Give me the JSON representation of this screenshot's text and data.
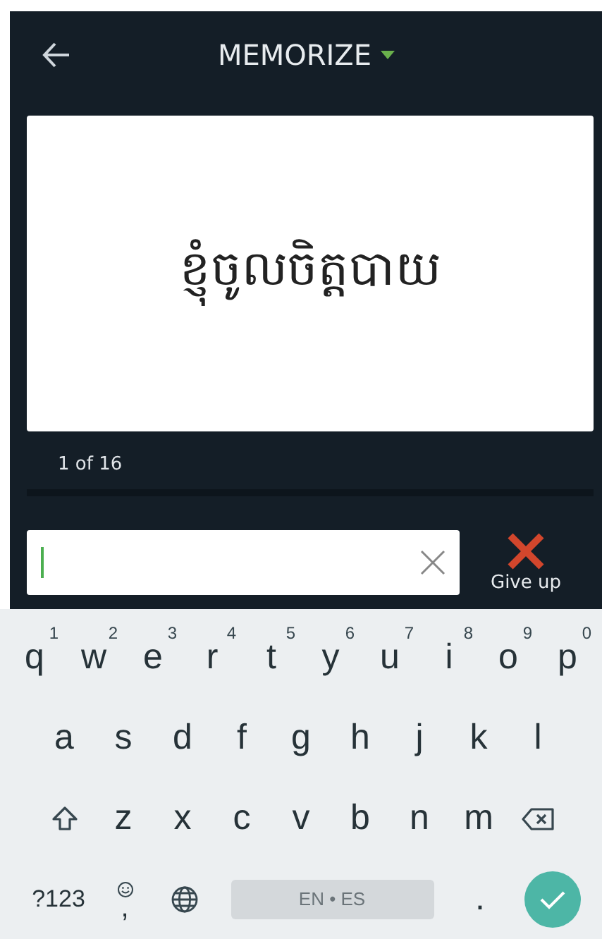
{
  "header": {
    "title": "MEMORIZE"
  },
  "card": {
    "prompt": "ខ្ញុំចូលចិត្តបាយ"
  },
  "progress": {
    "counter": "1 of 16"
  },
  "give_up": {
    "label": "Give up"
  },
  "keyboard": {
    "letter_rows": [
      [
        {
          "kind": "letter",
          "label": "q",
          "hint": "1"
        },
        {
          "kind": "letter",
          "label": "w",
          "hint": "2"
        },
        {
          "kind": "letter",
          "label": "e",
          "hint": "3"
        },
        {
          "kind": "letter",
          "label": "r",
          "hint": "4"
        },
        {
          "kind": "letter",
          "label": "t",
          "hint": "5"
        },
        {
          "kind": "letter",
          "label": "y",
          "hint": "6"
        },
        {
          "kind": "letter",
          "label": "u",
          "hint": "7"
        },
        {
          "kind": "letter",
          "label": "i",
          "hint": "8"
        },
        {
          "kind": "letter",
          "label": "o",
          "hint": "9"
        },
        {
          "kind": "letter",
          "label": "p",
          "hint": "0"
        }
      ],
      [
        {
          "kind": "letter",
          "label": "a"
        },
        {
          "kind": "letter",
          "label": "s"
        },
        {
          "kind": "letter",
          "label": "d"
        },
        {
          "kind": "letter",
          "label": "f"
        },
        {
          "kind": "letter",
          "label": "g"
        },
        {
          "kind": "letter",
          "label": "h"
        },
        {
          "kind": "letter",
          "label": "j"
        },
        {
          "kind": "letter",
          "label": "k"
        },
        {
          "kind": "letter",
          "label": "l"
        }
      ],
      [
        {
          "kind": "shift"
        },
        {
          "kind": "letter",
          "label": "z"
        },
        {
          "kind": "letter",
          "label": "x"
        },
        {
          "kind": "letter",
          "label": "c"
        },
        {
          "kind": "letter",
          "label": "v"
        },
        {
          "kind": "letter",
          "label": "b"
        },
        {
          "kind": "letter",
          "label": "n"
        },
        {
          "kind": "letter",
          "label": "m"
        },
        {
          "kind": "backspace"
        }
      ]
    ],
    "bottom_row": [
      {
        "kind": "symbols",
        "label": "?123"
      },
      {
        "kind": "emoji",
        "label": ","
      },
      {
        "kind": "globe"
      },
      {
        "kind": "space",
        "label": "EN • ES"
      },
      {
        "kind": "letter",
        "label": "."
      },
      {
        "kind": "enter"
      }
    ]
  }
}
